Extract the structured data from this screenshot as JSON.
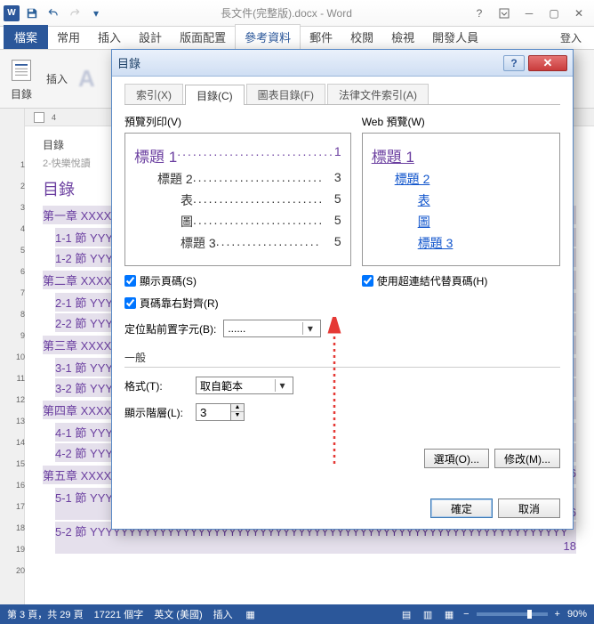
{
  "titlebar": {
    "doc_title": "長文件(完整版).docx - Word"
  },
  "ribbon": {
    "file": "檔案",
    "tabs": [
      "常用",
      "插入",
      "設計",
      "版面配置",
      "參考資料",
      "郵件",
      "校閱",
      "檢視",
      "開發人員"
    ],
    "active_index": 4,
    "login": "登入"
  },
  "ribbon_groups": {
    "toc": "目錄",
    "insert": "插入"
  },
  "doc": {
    "small_title": "2-快樂悅讀",
    "toc_heading": "目錄",
    "nav_label": "目錄",
    "chapters": [
      {
        "title": "第一章",
        "sections": [
          "1-1 節",
          "1-2 節"
        ]
      },
      {
        "title": "第二章",
        "sections": [
          "2-1 節",
          "2-2 節"
        ]
      },
      {
        "title": "第三章",
        "sections": [
          "3-1 節",
          "3-2 節"
        ]
      },
      {
        "title": "第四章",
        "sections": [
          "4-1 節",
          "4-2 節"
        ]
      },
      {
        "title": "第五章",
        "sections": [
          "5-1 節",
          "5-2 節"
        ]
      }
    ],
    "page_right": [
      "16",
      "16",
      "18"
    ]
  },
  "dialog": {
    "title": "目錄",
    "tabs": {
      "index": "索引(X)",
      "toc": "目錄(C)",
      "figures": "圖表目錄(F)",
      "legal": "法律文件索引(A)"
    },
    "print_preview_label": "預覽列印(V)",
    "web_preview_label": "Web 預覽(W)",
    "print_lines": [
      {
        "level": 1,
        "text": "標題 1",
        "page": "1"
      },
      {
        "level": 2,
        "text": "標題 2",
        "page": "3"
      },
      {
        "level": 3,
        "text": "表",
        "page": "5"
      },
      {
        "level": 3,
        "text": "圖",
        "page": "5"
      },
      {
        "level": 3,
        "text": "標題 3",
        "page": "5"
      }
    ],
    "web_lines": [
      {
        "level": 1,
        "text": "標題 1"
      },
      {
        "level": 2,
        "text": "標題 2"
      },
      {
        "level": 3,
        "text": "表"
      },
      {
        "level": 3,
        "text": "圖"
      },
      {
        "level": 3,
        "text": "標題 3"
      }
    ],
    "show_page_numbers": "顯示頁碼(S)",
    "right_align": "頁碼靠右對齊(R)",
    "use_hyperlinks": "使用超連結代替頁碼(H)",
    "tab_leader_label": "定位點前置字元(B):",
    "tab_leader_value": "......",
    "general_label": "一般",
    "format_label": "格式(T):",
    "format_value": "取自範本",
    "levels_label": "顯示階層(L):",
    "levels_value": "3",
    "options_btn": "選項(O)...",
    "modify_btn": "修改(M)...",
    "ok_btn": "確定",
    "cancel_btn": "取消"
  },
  "status": {
    "page": "第 3 頁，共 29 頁",
    "words": "17221 個字",
    "lang": "英文 (美國)",
    "insert": "插入",
    "zoom": "90%"
  }
}
